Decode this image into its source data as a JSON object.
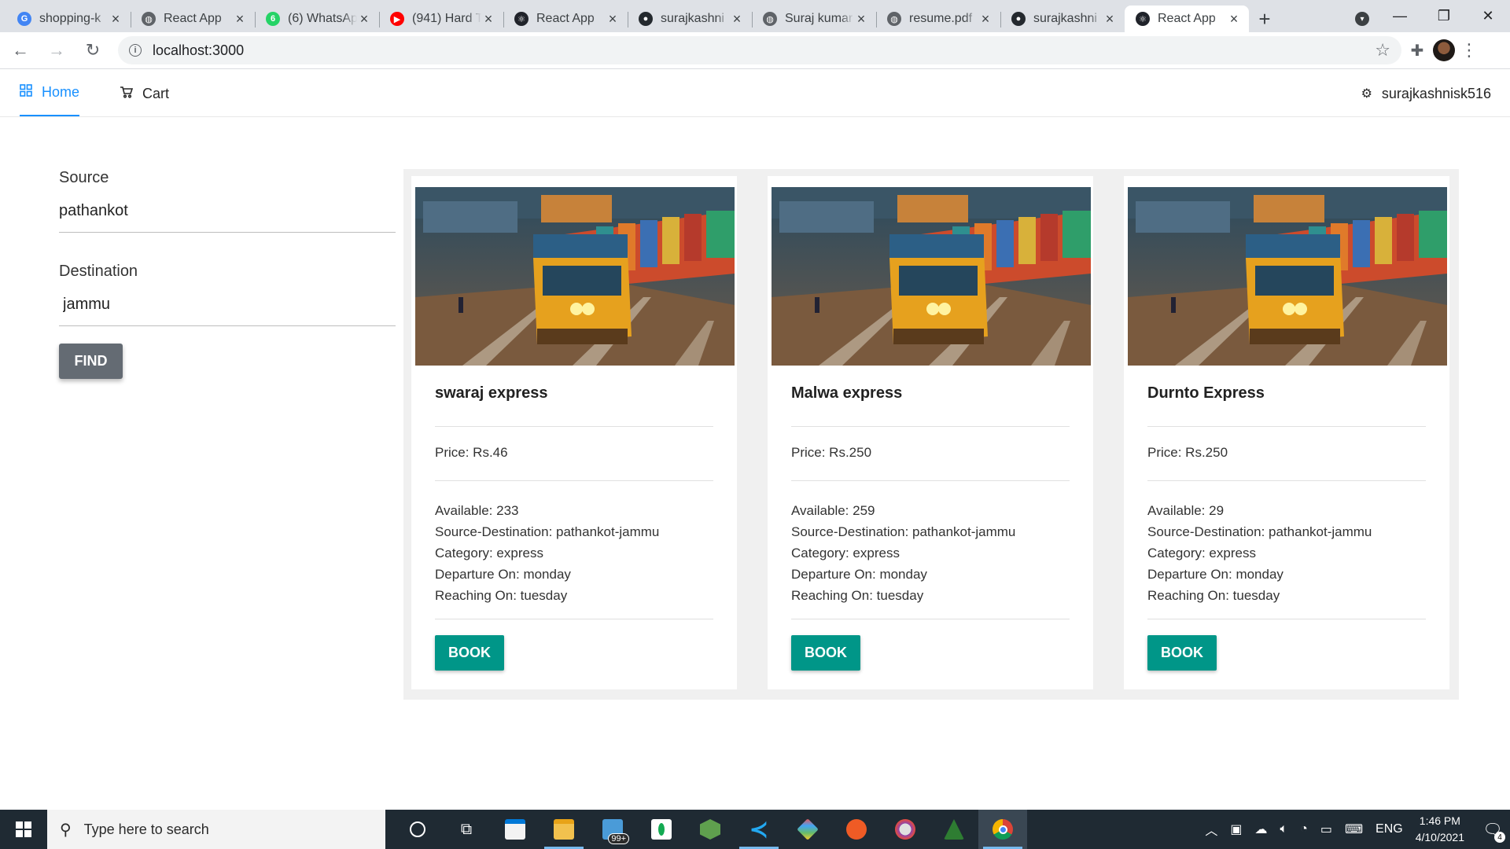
{
  "browser": {
    "tabs": [
      {
        "title": "shopping-k",
        "favicon": "google-icon",
        "color": "#4285f4",
        "glyph": "G"
      },
      {
        "title": "React App",
        "favicon": "globe-icon",
        "color": "#5f6368",
        "glyph": "◍"
      },
      {
        "title": "(6) WhatsAp",
        "favicon": "whatsapp-icon",
        "color": "#25d366",
        "glyph": "6"
      },
      {
        "title": "(941) Hard T",
        "favicon": "youtube-icon",
        "color": "#ff0000",
        "glyph": "▶"
      },
      {
        "title": "React App",
        "favicon": "react-icon",
        "color": "#20232a",
        "glyph": "⚛"
      },
      {
        "title": "surajkashni",
        "favicon": "github-icon",
        "color": "#24292e",
        "glyph": "●"
      },
      {
        "title": "Suraj kumar",
        "favicon": "globe-icon",
        "color": "#5f6368",
        "glyph": "◍"
      },
      {
        "title": "resume.pdf",
        "favicon": "globe-icon",
        "color": "#5f6368",
        "glyph": "◍"
      },
      {
        "title": "surajkashni",
        "favicon": "github-icon",
        "color": "#24292e",
        "glyph": "●"
      },
      {
        "title": "React App",
        "favicon": "react-icon",
        "color": "#20232a",
        "glyph": "⚛"
      }
    ],
    "active_tab_index": 9,
    "url": "localhost:3000"
  },
  "app_nav": {
    "home_label": "Home",
    "cart_label": "Cart",
    "user_label": "surajkashnisk516"
  },
  "search": {
    "source_label": "Source",
    "source_value": "pathankot",
    "destination_label": "Destination",
    "destination_value": "jammu",
    "find_label": "FIND"
  },
  "trains": [
    {
      "name": "swaraj express",
      "price": "Price: Rs.46",
      "available": "Available: 233",
      "route": "Source-Destination: pathankot-jammu",
      "category": "Category: express",
      "departure": "Departure On: monday",
      "reaching": "Reaching On: tuesday",
      "book_label": "BOOK"
    },
    {
      "name": "Malwa express",
      "price": "Price: Rs.250",
      "available": "Available: 259",
      "route": "Source-Destination: pathankot-jammu",
      "category": "Category: express",
      "departure": "Departure On: monday",
      "reaching": "Reaching On: tuesday",
      "book_label": "BOOK"
    },
    {
      "name": "Durnto Express",
      "price": "Price: Rs.250",
      "available": "Available: 29",
      "route": "Source-Destination: pathankot-jammu",
      "category": "Category: express",
      "departure": "Departure On: monday",
      "reaching": "Reaching On: tuesday",
      "book_label": "BOOK"
    }
  ],
  "taskbar": {
    "search_placeholder": "Type here to search",
    "mail_badge": "99+",
    "language": "ENG",
    "time": "1:46 PM",
    "date": "4/10/2021",
    "notification_count": "4"
  },
  "colors": {
    "accent": "#1890ff",
    "book_button": "#009688",
    "find_button": "#646b73"
  }
}
